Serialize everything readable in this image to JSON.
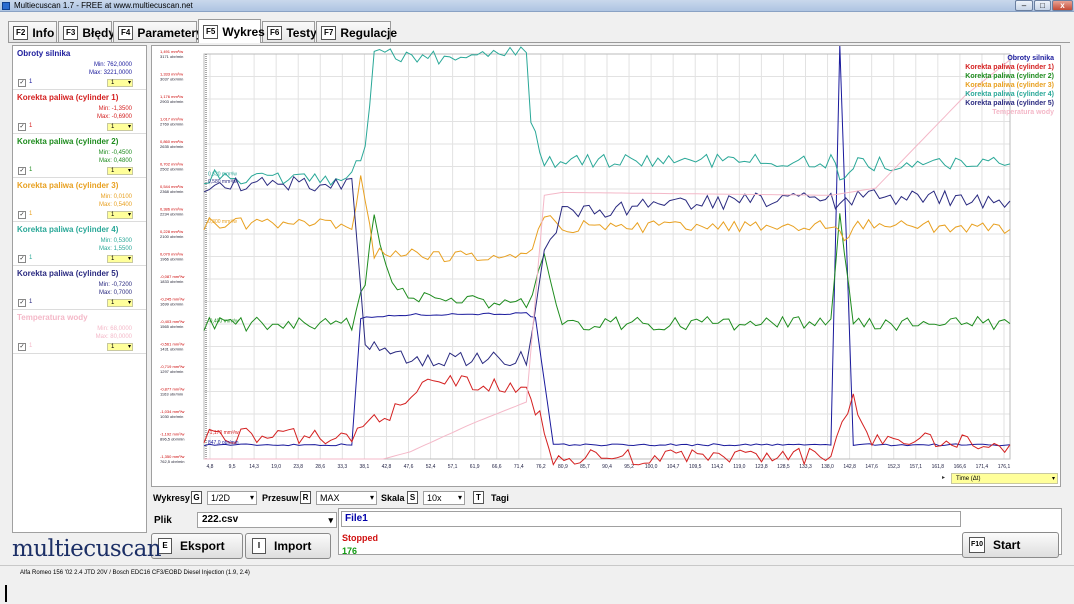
{
  "window": {
    "title": "Multiecuscan 1.7 - FREE at www.multiecuscan.net",
    "min_label": "–",
    "max_label": "□",
    "close_label": "x"
  },
  "tabs": [
    {
      "key": "F2",
      "label": "Info",
      "active": false
    },
    {
      "key": "F3",
      "label": "Błędy",
      "active": false
    },
    {
      "key": "F4",
      "label": "Parametery",
      "active": false
    },
    {
      "key": "F5",
      "label": "Wykres",
      "active": true
    },
    {
      "key": "F6",
      "label": "Testy",
      "active": false
    },
    {
      "key": "F7",
      "label": "Regulacje",
      "active": false
    }
  ],
  "signals": [
    {
      "name": "Obroty silnika",
      "min": "Min: 762,0000",
      "max": "Max: 3221,0000",
      "checked": true,
      "count": "1",
      "scale": "1",
      "color": "#1a1a9c"
    },
    {
      "name": "Korekta paliwa (cylinder 1)",
      "min": "Min: -1,3500",
      "max": "Max: -0,6900",
      "checked": true,
      "count": "1",
      "scale": "1",
      "color": "#d42020"
    },
    {
      "name": "Korekta paliwa (cylinder 2)",
      "min": "Min: -0,4500",
      "max": "Max: 0,4800",
      "checked": true,
      "count": "1",
      "scale": "1",
      "color": "#1e8c1e"
    },
    {
      "name": "Korekta paliwa (cylinder 3)",
      "min": "Min: 0,0100",
      "max": "Max: 0,5400",
      "checked": true,
      "count": "1",
      "scale": "1",
      "color": "#e8a020"
    },
    {
      "name": "Korekta paliwa (cylinder 4)",
      "min": "Min: 0,5300",
      "max": "Max: 1,5500",
      "checked": true,
      "count": "1",
      "scale": "1",
      "color": "#2aa898"
    },
    {
      "name": "Korekta paliwa (cylinder 5)",
      "min": "Min: -0,7200",
      "max": "Max: 0,7000",
      "checked": true,
      "count": "1",
      "scale": "1",
      "color": "#2a2a80"
    },
    {
      "name": "Temperatura wody",
      "min": "Min: 68,0000",
      "max": "Max: 80,0000",
      "checked": true,
      "count": "1",
      "scale": "1",
      "color": "#f4b8c8"
    }
  ],
  "controls": {
    "wykresy_label": "Wykresy",
    "wykresy_key": "G",
    "wykresy_value": "1/2D",
    "przesuw_label": "Przesuw",
    "przesuw_key": "R",
    "przesuw_value": "MAX",
    "skala_label": "Skala",
    "skala_key": "S",
    "skala_value": "10x",
    "tagi_key": "T",
    "tagi_label": "Tagi"
  },
  "file": {
    "label": "Plik",
    "value": "222.csv",
    "export_key": "E",
    "export_label": "Eksport",
    "import_key": "I",
    "import_label": "Import",
    "name": "File1",
    "status": "Stopped",
    "count": "176",
    "start_key": "F10",
    "start_label": "Start"
  },
  "logo": "multiecuscan",
  "statusbar": "Alfa Romeo 156 '02 2.4 JTD 20V / Bosch EDC16 CF3/EOBD Diesel Injection (1.9, 2.4)",
  "chart_data": {
    "type": "line",
    "x_axis_selector": "Time (Δt)",
    "xlim": [
      0,
      180
    ],
    "x_ticks": [
      "4,8",
      "9,5",
      "14,3",
      "19,0",
      "23,8",
      "28,6",
      "33,3",
      "38,1",
      "42,8",
      "47,6",
      "52,4",
      "57,1",
      "61,9",
      "66,6",
      "71,4",
      "76,2",
      "80,9",
      "85,7",
      "90,4",
      "95,2",
      "100,0",
      "104,7",
      "109,5",
      "114,2",
      "119,0",
      "123,8",
      "128,5",
      "133,3",
      "138,0",
      "142,8",
      "147,6",
      "152,3",
      "157,1",
      "161,8",
      "166,6",
      "171,4",
      "176,1"
    ],
    "y_ticks_fuel": [
      "1,491 mm³/w",
      "1,333 mm³/w",
      "1,176 mm³/w",
      "1,017 mm³/w",
      "0,860 mm³/w",
      "0,702 mm³/w",
      "0,544 mm³/w",
      "0,386 mm³/w",
      "0,228 mm³/w",
      "0,070 mm³/w",
      "-0,087 mm³/w",
      "-0,245 mm³/w",
      "-0,403 mm³/w",
      "-0,561 mm³/w",
      "-0,719 mm³/w",
      "-0,877 mm³/w",
      "-1,034 mm³/w",
      "-1,192 mm³/w",
      "-1,350 mm³/w"
    ],
    "y_ticks_rpm": [
      "3171 obr/min",
      "3037 obr/min",
      "2903 obr/min",
      "2769 obr/min",
      "2635 obr/min",
      "2502 obr/min",
      "2368 obr/min",
      "2234 obr/min",
      "2100 obr/min",
      "1966 obr/min",
      "1833 obr/min",
      "1699 obr/min",
      "1565 obr/min",
      "1431 obr/min",
      "1297 obr/min",
      "1163 obr/min",
      "1030 obr/min",
      "896,5 obr/min",
      "762,5 obr/min"
    ],
    "cursor_labels": [
      {
        "text": "0,630 mm³/w",
        "series": 4
      },
      {
        "text": "0,580 mm³/w",
        "series": 5
      },
      {
        "text": "0,300 mm³/w",
        "series": 3
      },
      {
        "text": "-0,400 mm³/w",
        "series": 2
      },
      {
        "text": "-1,170 mm³/w",
        "series": 1
      },
      {
        "text": "847,0 obr/min",
        "series": 0
      }
    ],
    "legend": [
      "Obroty silnika",
      "Korekta paliwa (cylinder 1)",
      "Korekta paliwa (cylinder 2)",
      "Korekta paliwa (cylinder 3)",
      "Korekta paliwa (cylinder 4)",
      "Korekta paliwa (cylinder 5)",
      "Temperatura wody"
    ],
    "legend_position": "top-right",
    "grid": true,
    "series_segments": [
      [
        [
          0,
          847
        ],
        [
          33,
          847
        ],
        [
          35,
          1600
        ],
        [
          45,
          1620
        ],
        [
          60,
          1625
        ],
        [
          72,
          1628
        ],
        [
          74,
          1600
        ],
        [
          78,
          847
        ],
        [
          140,
          847
        ],
        [
          142,
          3221
        ],
        [
          145,
          847
        ],
        [
          180,
          847
        ]
      ],
      [
        [
          0,
          -1.18
        ],
        [
          33,
          -1.2
        ],
        [
          38,
          -1.05
        ],
        [
          45,
          -1.0
        ],
        [
          50,
          -0.79
        ],
        [
          60,
          -0.82
        ],
        [
          72,
          -0.88
        ],
        [
          75,
          -1.05
        ],
        [
          78,
          -1.34
        ],
        [
          140,
          -1.33
        ],
        [
          145,
          -0.88
        ],
        [
          148,
          -1.2
        ],
        [
          180,
          -1.25
        ]
      ],
      [
        [
          0,
          -0.4
        ],
        [
          33,
          -0.41
        ],
        [
          36,
          -0.1
        ],
        [
          38,
          0.36
        ],
        [
          42,
          -0.12
        ],
        [
          48,
          -0.22
        ],
        [
          60,
          -0.25
        ],
        [
          72,
          -0.26
        ],
        [
          76,
          0.05
        ],
        [
          80,
          -0.4
        ],
        [
          140,
          -0.4
        ],
        [
          142,
          0.35
        ],
        [
          145,
          -0.4
        ],
        [
          180,
          -0.4
        ]
      ],
      [
        [
          0,
          0.3
        ],
        [
          33,
          0.3
        ],
        [
          35,
          0.6
        ],
        [
          38,
          0.1
        ],
        [
          50,
          0.08
        ],
        [
          72,
          0.06
        ],
        [
          76,
          0.35
        ],
        [
          80,
          0.28
        ],
        [
          140,
          0.28
        ],
        [
          143,
          0.2
        ],
        [
          146,
          0.3
        ],
        [
          180,
          0.26
        ]
      ],
      [
        [
          0,
          0.63
        ],
        [
          33,
          0.62
        ],
        [
          36,
          0.85
        ],
        [
          38,
          1.51
        ],
        [
          50,
          1.46
        ],
        [
          72,
          1.5
        ],
        [
          73,
          1.05
        ],
        [
          76,
          0.74
        ],
        [
          140,
          0.74
        ],
        [
          143,
          0.6
        ],
        [
          146,
          0.72
        ],
        [
          180,
          0.72
        ]
      ],
      [
        [
          0,
          0.58
        ],
        [
          33,
          0.58
        ],
        [
          36,
          -0.5
        ],
        [
          38,
          -0.58
        ],
        [
          50,
          -0.66
        ],
        [
          72,
          -0.65
        ],
        [
          76,
          0.1
        ],
        [
          80,
          0.38
        ],
        [
          140,
          0.5
        ],
        [
          142,
          0.4
        ],
        [
          146,
          0.5
        ],
        [
          180,
          0.46
        ]
      ],
      [
        [
          0,
          -1.35
        ],
        [
          40,
          -1.35
        ],
        [
          46,
          -1.3
        ],
        [
          60,
          -1.1
        ],
        [
          72,
          -0.95
        ],
        [
          76,
          0.5
        ],
        [
          80,
          0.52
        ],
        [
          140,
          0.5
        ],
        [
          150,
          0.55
        ],
        [
          170,
          1.2
        ],
        [
          180,
          1.45
        ]
      ]
    ]
  }
}
